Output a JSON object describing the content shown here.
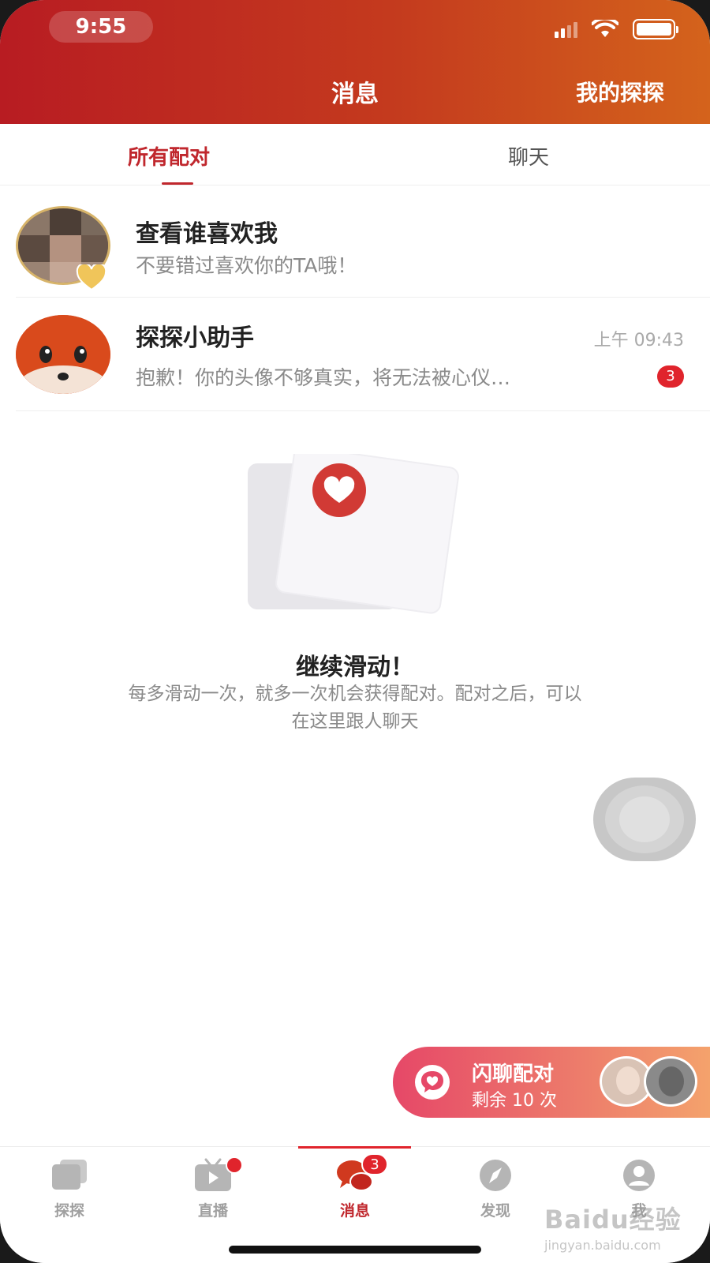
{
  "status_bar": {
    "time": "9:55"
  },
  "header": {
    "title": "消息",
    "right_link": "我的探探"
  },
  "tabs": [
    {
      "label": "所有配对",
      "active": true
    },
    {
      "label": "聊天",
      "active": false
    }
  ],
  "list": [
    {
      "title": "查看谁喜欢我",
      "subtitle": "不要错过喜欢你的TA哦！"
    },
    {
      "title": "探探小助手",
      "subtitle": "抱歉！你的头像不够真实，将无法被心仪…",
      "time": "上午 09:43",
      "unread": "3"
    }
  ],
  "empty_state": {
    "title": "继续滑动！",
    "line1": "每多滑动一次，就多一次机会获得配对。配对之后，可以",
    "line2": "在这里跟人聊天"
  },
  "flash_chat": {
    "title": "闪聊配对",
    "subtitle": "剩余 10 次"
  },
  "bottom_nav": [
    {
      "label": "探探",
      "icon": "cards-icon"
    },
    {
      "label": "直播",
      "icon": "live-tv-icon"
    },
    {
      "label": "消息",
      "icon": "chat-bubbles-icon",
      "badge": "3",
      "active": true
    },
    {
      "label": "发现",
      "icon": "compass-icon"
    },
    {
      "label": "我",
      "icon": "person-icon"
    }
  ],
  "watermark": {
    "brand": "Baidu经验",
    "url": "jingyan.baidu.com"
  },
  "colors": {
    "brand_red": "#c0272d",
    "header_start": "#b81c22",
    "header_end": "#d4631c",
    "badge_red": "#e0242c"
  }
}
